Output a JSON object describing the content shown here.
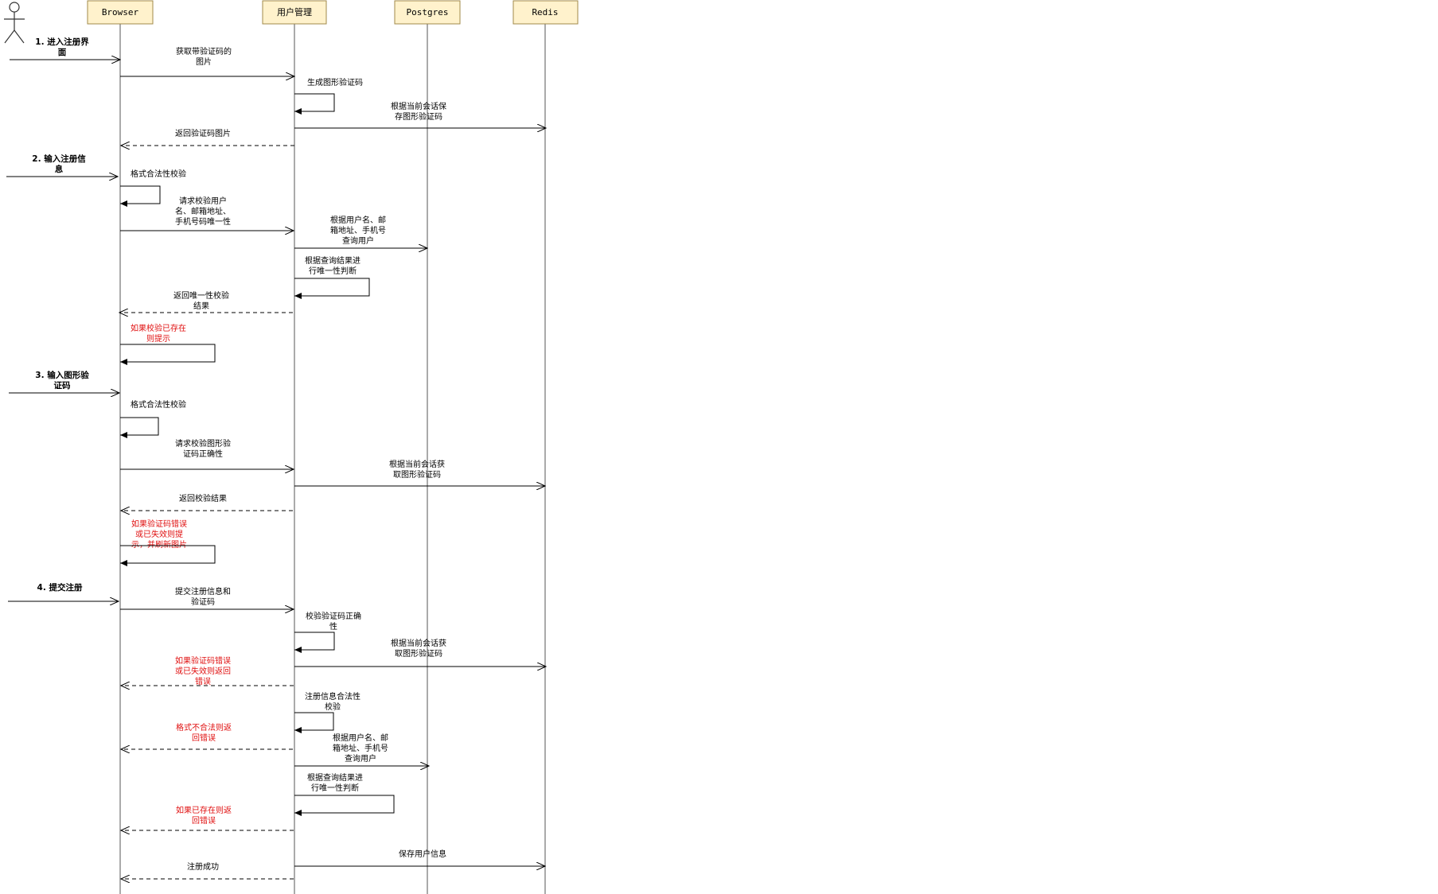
{
  "participants": [
    {
      "key": "browser",
      "label": "Browser"
    },
    {
      "key": "user",
      "label": "用户管理"
    },
    {
      "key": "pg",
      "label": "Postgres"
    },
    {
      "key": "redis",
      "label": "Redis"
    }
  ],
  "steps": [
    {
      "lines": [
        "1. 进入注册界",
        "面"
      ]
    },
    {
      "lines": [
        "2. 输入注册信",
        "息"
      ]
    },
    {
      "lines": [
        "3. 输入图形验",
        "证码"
      ]
    },
    {
      "lines": [
        "4. 提交注册"
      ]
    }
  ],
  "messages": [
    {
      "kind": "call",
      "lines": [
        "获取带验证码的",
        "图片"
      ]
    },
    {
      "kind": "self",
      "lines": [
        "生成图形验证码"
      ]
    },
    {
      "kind": "call",
      "lines": [
        "根据当前会话保",
        "存图形验证码"
      ]
    },
    {
      "kind": "return",
      "lines": [
        "返回验证码图片"
      ]
    },
    {
      "kind": "self",
      "lines": [
        "格式合法性校验"
      ]
    },
    {
      "kind": "call",
      "lines": [
        "请求校验用户",
        "名、邮箱地址、",
        "手机号码唯一性"
      ]
    },
    {
      "kind": "call",
      "lines": [
        "根据用户名、邮",
        "箱地址、手机号",
        "查询用户"
      ]
    },
    {
      "kind": "self",
      "lines": [
        "根据查询结果进",
        "行唯一性判断"
      ]
    },
    {
      "kind": "return",
      "lines": [
        "返回唯一性校验",
        "结果"
      ]
    },
    {
      "kind": "self",
      "red": true,
      "lines": [
        "如果校验已存在",
        "则提示"
      ]
    },
    {
      "kind": "self",
      "lines": [
        "格式合法性校验"
      ]
    },
    {
      "kind": "call",
      "lines": [
        "请求校验图形验",
        "证码正确性"
      ]
    },
    {
      "kind": "call",
      "lines": [
        "根据当前会话获",
        "取图形验证码"
      ]
    },
    {
      "kind": "return",
      "lines": [
        "返回校验结果"
      ]
    },
    {
      "kind": "self",
      "red": true,
      "lines": [
        "如果验证码错误",
        "或已失效则提",
        "示，并刷新图片"
      ]
    },
    {
      "kind": "call",
      "lines": [
        "提交注册信息和",
        "验证码"
      ]
    },
    {
      "kind": "self",
      "lines": [
        "校验验证码正确",
        "性"
      ]
    },
    {
      "kind": "call",
      "lines": [
        "根据当前会话获",
        "取图形验证码"
      ]
    },
    {
      "kind": "return",
      "red": true,
      "lines": [
        "如果验证码错误",
        "或已失效则返回",
        "错误"
      ]
    },
    {
      "kind": "self",
      "lines": [
        "注册信息合法性",
        "校验"
      ]
    },
    {
      "kind": "return",
      "red": true,
      "lines": [
        "格式不合法则返",
        "回错误"
      ]
    },
    {
      "kind": "call",
      "lines": [
        "根据用户名、邮",
        "箱地址、手机号",
        "查询用户"
      ]
    },
    {
      "kind": "self",
      "lines": [
        "根据查询结果进",
        "行唯一性判断"
      ]
    },
    {
      "kind": "return",
      "red": true,
      "lines": [
        "如果已存在则返",
        "回错误"
      ]
    },
    {
      "kind": "call",
      "lines": [
        "保存用户信息"
      ]
    },
    {
      "kind": "return",
      "lines": [
        "注册成功"
      ]
    }
  ],
  "colors": {
    "header_fill": "#fff2cc",
    "header_stroke": "#a08a4a",
    "note_red": "#e01010"
  }
}
